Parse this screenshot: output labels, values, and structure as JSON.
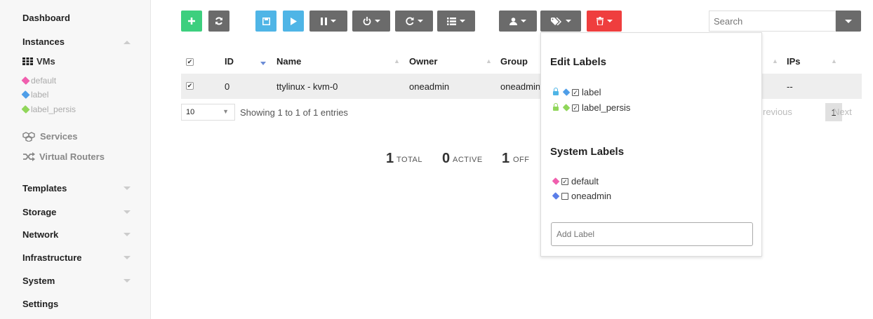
{
  "sidebar": {
    "dashboard": "Dashboard",
    "instances": "Instances",
    "vms": "VMs",
    "labels": [
      {
        "text": "default",
        "color": "#f05fae"
      },
      {
        "text": "label",
        "color": "#4f9ee8"
      },
      {
        "text": "label_persis",
        "color": "#90d65a"
      }
    ],
    "services": "Services",
    "virtual_routers": "Virtual Routers",
    "templates": "Templates",
    "storage": "Storage",
    "network": "Network",
    "infrastructure": "Infrastructure",
    "system": "System",
    "settings": "Settings"
  },
  "toolbar": {
    "create_icon": "plus-icon",
    "refresh_icon": "refresh-icon",
    "search_placeholder": "Search"
  },
  "table": {
    "headers": [
      "ID",
      "Name",
      "Owner",
      "Group",
      "IPs"
    ],
    "rows": [
      {
        "id": "0",
        "name": "ttylinux - kvm-0",
        "owner": "oneadmin",
        "group": "oneadmin",
        "ips": "--"
      }
    ],
    "page_length": "10",
    "info": "Showing 1 to 1 of 1 entries",
    "pagination": {
      "previous": "revious",
      "current": "1",
      "next": "Next"
    }
  },
  "stats": {
    "total_n": "1",
    "total_l": "TOTAL",
    "active_n": "0",
    "active_l": "ACTIVE",
    "off_n": "1",
    "off_l": "OFF"
  },
  "labels_dropdown": {
    "edit_title": "Edit Labels",
    "edit_items": [
      {
        "text": "label",
        "lock_color": "#4fb5e6",
        "tag_color": "#4f9ee8"
      },
      {
        "text": "label_persis",
        "lock_color": "#90d65a",
        "tag_color": "#90d65a"
      }
    ],
    "system_title": "System Labels",
    "system_items": [
      {
        "text": "default",
        "checked": true,
        "tag_color": "#f05fae"
      },
      {
        "text": "oneadmin",
        "checked": false,
        "tag_color": "#5b7ee8"
      }
    ],
    "add_placeholder": "Add Label"
  },
  "colors": {
    "green": "#3dcf7e",
    "blue": "#4fb5e6",
    "dark_gray": "#6b6b6b",
    "red": "#ef3e3e"
  }
}
